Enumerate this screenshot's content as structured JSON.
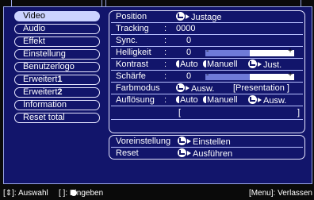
{
  "sidebar": {
    "items": [
      {
        "label": "Video"
      },
      {
        "label": "Audio"
      },
      {
        "label": "Effekt"
      },
      {
        "label": "Einstellung"
      },
      {
        "label": "Benutzerlogo"
      },
      {
        "label": "Erweitert",
        "suffix": "1"
      },
      {
        "label": "Erweitert",
        "suffix": "2"
      },
      {
        "label": "Information"
      },
      {
        "label": "Reset total"
      }
    ]
  },
  "panel": {
    "position": {
      "label": "Position",
      "action": "Justage"
    },
    "tracking": {
      "label": "Tracking",
      "value": "0000"
    },
    "sync": {
      "label": "Sync.",
      "value": "0"
    },
    "helligkeit": {
      "label": "Helligkeit",
      "value": "0",
      "level": 0.5
    },
    "kontrast": {
      "label": "Kontrast",
      "opt1": "Auto",
      "opt2": "Manuell",
      "action": "Just."
    },
    "schaerfe": {
      "label": "Schärfe",
      "value": "0",
      "level": 0.5
    },
    "farbmodus": {
      "label": "Farbmodus",
      "action": "Ausw.",
      "value": "[Presentation ]"
    },
    "aufloesung": {
      "label": "Auflösung",
      "opt1": "Auto",
      "opt2": "Manuell",
      "action": "Ausw."
    },
    "bracket": {
      "open": "[",
      "close": "]"
    },
    "voreinstellung": {
      "label": "Voreinstellung",
      "action": "Einstellen"
    },
    "reset": {
      "label": "Reset",
      "action": "Ausführen"
    }
  },
  "footer": {
    "left": "[⇕]: Auswahl",
    "enter": "[ ]: Eingeben",
    "right": "[Menu]: Verlassen"
  },
  "colors": {
    "background": "#12156b",
    "selected": "#ccd3ff",
    "bar_fill": "#6f7bd8"
  }
}
